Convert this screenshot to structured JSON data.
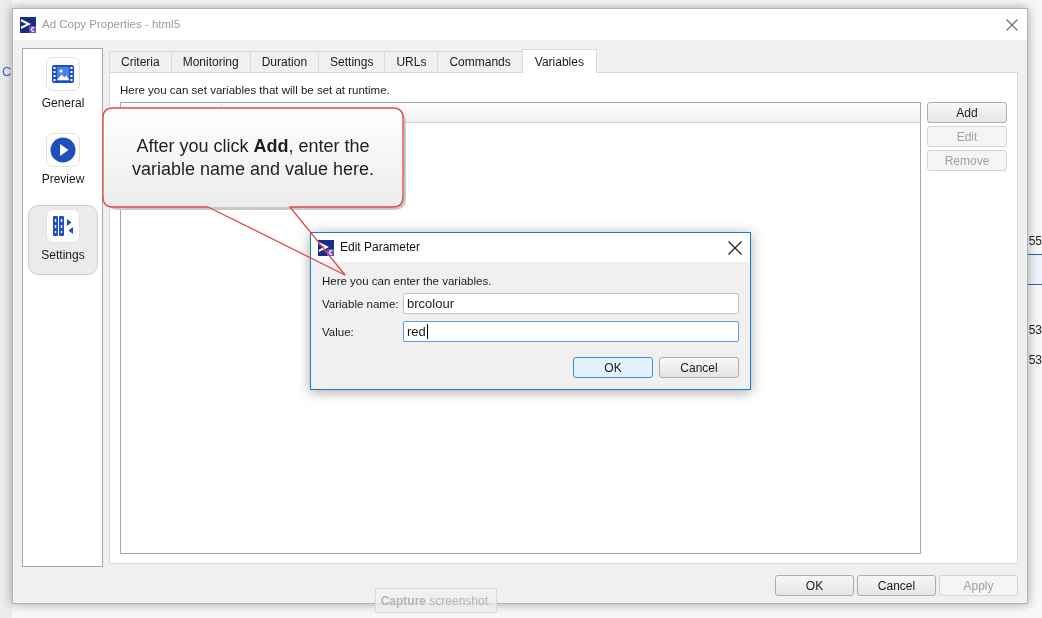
{
  "background_app": {
    "side_text": "C",
    "values": [
      "55",
      "53",
      "53"
    ],
    "capture_button": "**Capture** screenshot."
  },
  "window": {
    "title": "Ad Copy Properties - html5"
  },
  "sidebar": {
    "items": [
      {
        "kind": "image",
        "label": "General",
        "selected": false
      },
      {
        "kind": "play",
        "label": "Preview",
        "selected": false
      },
      {
        "kind": "columns",
        "label": "Settings",
        "selected": true
      }
    ]
  },
  "tabs": [
    {
      "label": "Criteria",
      "selected": false
    },
    {
      "label": "Monitoring",
      "selected": false
    },
    {
      "label": "Duration",
      "selected": false
    },
    {
      "label": "Settings",
      "selected": false
    },
    {
      "label": "URLs",
      "selected": false
    },
    {
      "label": "Commands",
      "selected": false
    },
    {
      "label": "Variables",
      "selected": true
    }
  ],
  "variables_page": {
    "description": "Here you can set variables that will be set at runtime.",
    "buttons": [
      {
        "label": "Add",
        "disabled": false
      },
      {
        "label": "Edit",
        "disabled": true
      },
      {
        "label": "Remove",
        "disabled": true
      }
    ]
  },
  "footer_buttons": [
    {
      "label": "OK",
      "disabled": false
    },
    {
      "label": "Cancel",
      "disabled": false
    },
    {
      "label": "Apply",
      "disabled": true
    }
  ],
  "callout": {
    "text": "After you click **Add**, enter the variable name and value here."
  },
  "dialog": {
    "title": "Edit Parameter",
    "description": "Here you can enter the variables.",
    "fields": [
      {
        "label": "Variable name:",
        "value": "brcolour",
        "focused": false
      },
      {
        "label": "Value:",
        "value": "red",
        "focused": true
      }
    ],
    "buttons": [
      {
        "label": "OK",
        "default": true
      },
      {
        "label": "Cancel",
        "default": false
      }
    ]
  }
}
